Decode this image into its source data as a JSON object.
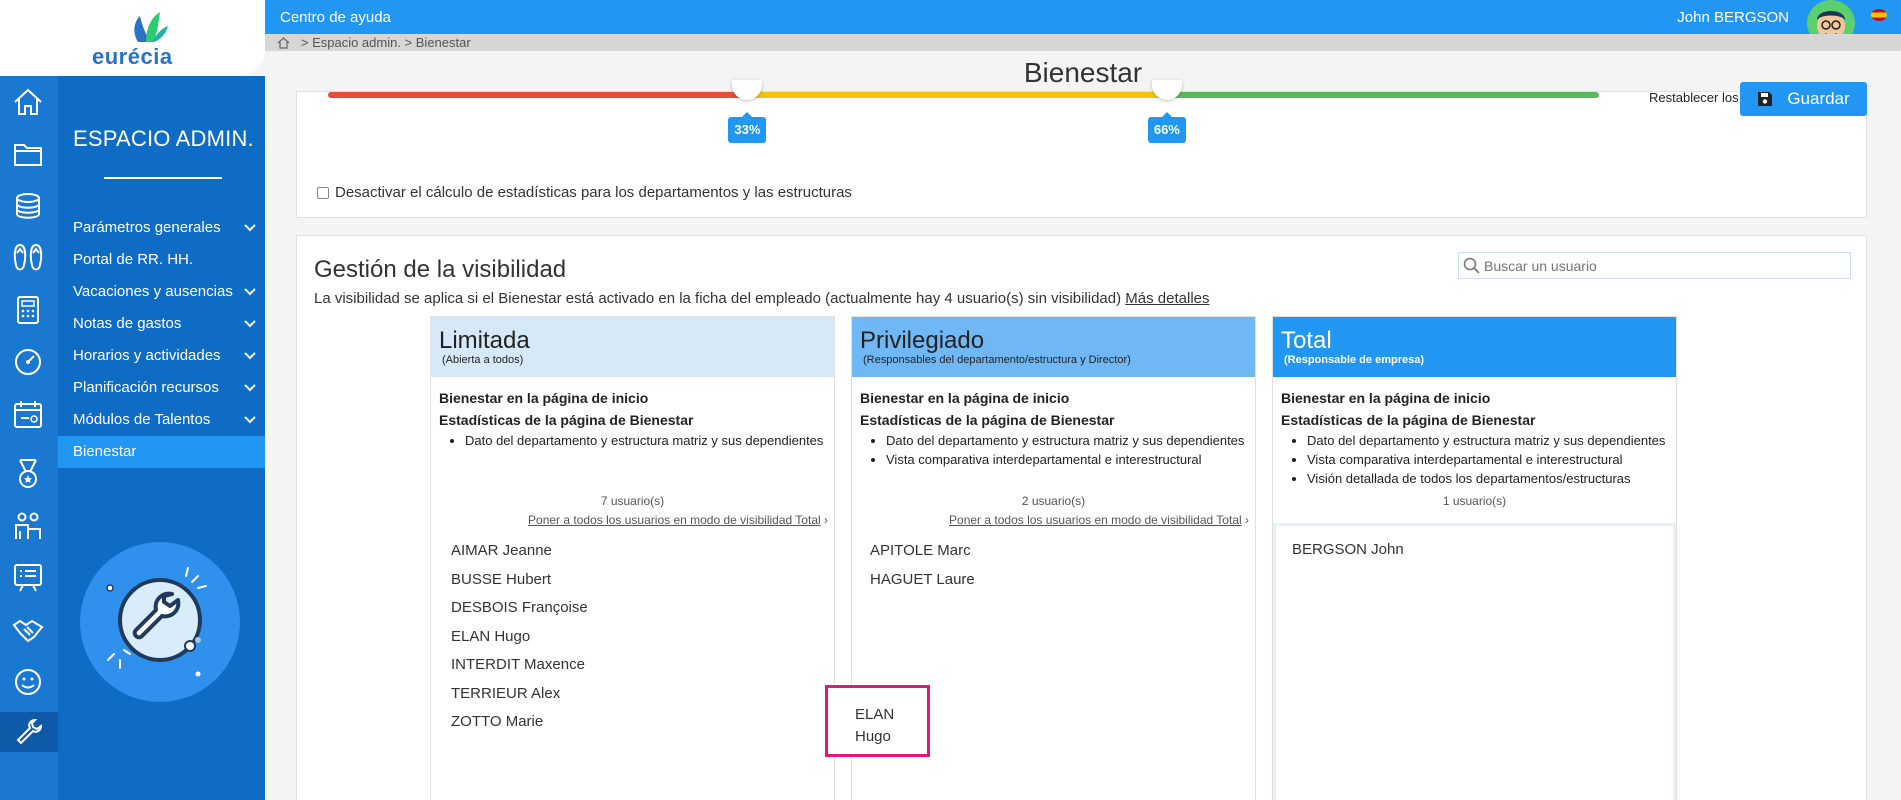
{
  "topbar": {
    "help": "Centro de ayuda",
    "user": "John  BERGSON"
  },
  "breadcrumb": {
    "text": "> Espacio admin. > Bienestar"
  },
  "logo": {
    "word": "eurécia"
  },
  "sidebar": {
    "title": "ESPACIO ADMIN.",
    "items": [
      {
        "label": "Parámetros generales",
        "chevron": true
      },
      {
        "label": "Portal de RR. HH.",
        "chevron": false
      },
      {
        "label": "Vacaciones y ausencias",
        "chevron": true
      },
      {
        "label": "Notas de gastos",
        "chevron": true
      },
      {
        "label": "Horarios y actividades",
        "chevron": true
      },
      {
        "label": "Planificación recursos",
        "chevron": true
      },
      {
        "label": "Módulos de Talentos",
        "chevron": true
      },
      {
        "label": "Bienestar",
        "chevron": false,
        "active": true
      }
    ]
  },
  "page": {
    "title": "Bienestar",
    "save_label": "Guardar"
  },
  "thresholds": {
    "low": "33%",
    "high": "66%",
    "low_value": 33,
    "high_value": 66,
    "colors": {
      "low": "#e74c3c",
      "mid": "#f1c40f",
      "high": "#5cb85c"
    },
    "reset_label": "Restablecer los valores"
  },
  "stats_toggle": {
    "label": "Desactivar el cálculo de estadísticas para los departamentos y las estructuras",
    "checked": false
  },
  "visibility": {
    "title": "Gestión de la visibilidad",
    "desc": "La visibilidad se aplica si el Bienestar está activado en la ficha del empleado (actualmente hay 4 usuario(s) sin visibilidad)",
    "more": "Más detalles",
    "search_placeholder": "Buscar un usuario",
    "columns": [
      {
        "name": "Limitada",
        "sub": "(Abierta a todos)",
        "header_color": "#d6e9f8",
        "home": "Bienestar en la página de inicio",
        "stats": "Estadísticas de la página de Bienestar",
        "bullets": [
          "Dato del departamento y estructura matriz y sus dependientes"
        ],
        "count": "7 usuario(s)",
        "move": "Poner a todos los usuarios en modo de visibilidad Total",
        "users": [
          "AIMAR Jeanne",
          "BUSSE Hubert",
          "DESBOIS Françoise",
          "ELAN Hugo",
          "INTERDIT Maxence",
          "TERRIEUR Alex",
          "ZOTTO Marie"
        ]
      },
      {
        "name": "Privilegiado",
        "sub": "(Responsables del departamento/estructura y Director)",
        "header_color": "#6fb8f5",
        "home": "Bienestar en la página de inicio",
        "stats": "Estadísticas de la página de Bienestar",
        "bullets": [
          "Dato del departamento y estructura matriz y sus dependientes",
          "Vista comparativa interdepartamental e interestructural"
        ],
        "count": "2 usuario(s)",
        "move": "Poner a todos los usuarios en modo de visibilidad Total",
        "users": [
          "APITOLE Marc",
          "HAGUET Laure"
        ]
      },
      {
        "name": "Total",
        "sub": "(Responsable de empresa)",
        "header_color": "#2196f3",
        "home": "Bienestar en la página de inicio",
        "stats": "Estadísticas de la página de Bienestar",
        "bullets": [
          "Dato del departamento y estructura matriz y sus dependientes",
          "Vista comparativa interdepartamental e interestructural",
          "Visión detallada de todos los departamentos/estructuras"
        ],
        "count": "1 usuario(s)",
        "users": [
          "BERGSON John"
        ]
      }
    ],
    "drag_ghost": {
      "line1": "ELAN",
      "line2": "Hugo"
    }
  }
}
